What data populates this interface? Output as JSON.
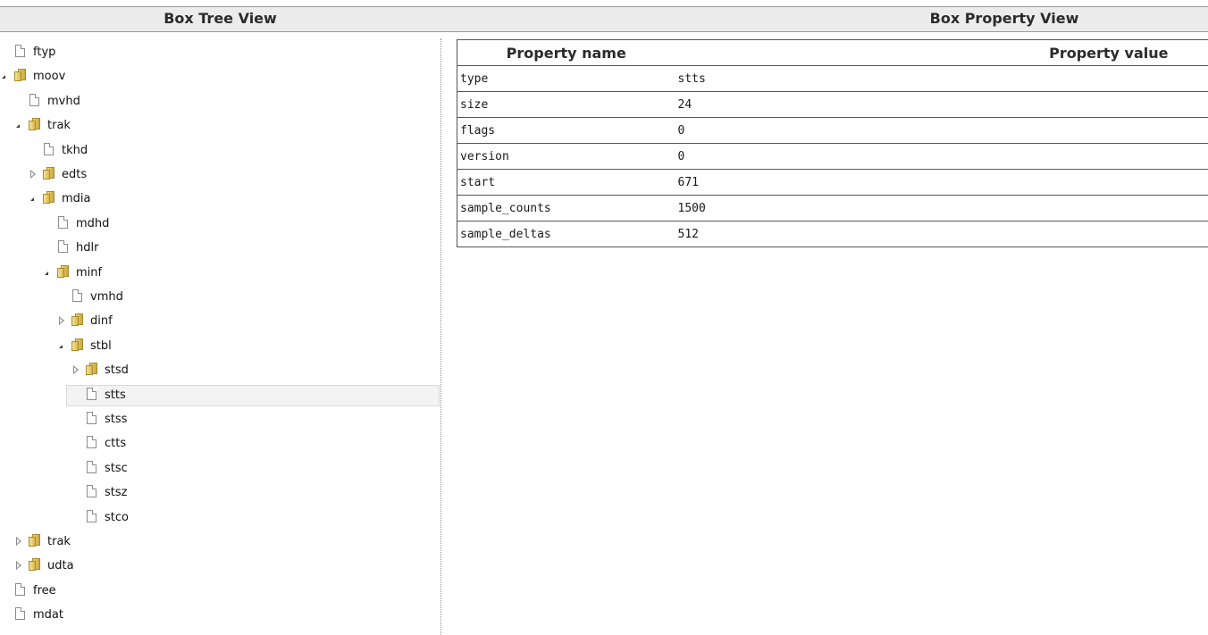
{
  "headers": {
    "tree_title": "Box Tree View",
    "property_title": "Box Property View"
  },
  "tree": {
    "nodes": [
      {
        "label": "ftyp",
        "icon": "file-icon",
        "toggle": "none",
        "depth": 0
      },
      {
        "label": "moov",
        "icon": "folder-icon",
        "toggle": "expanded",
        "depth": 0
      },
      {
        "label": "mvhd",
        "icon": "file-icon",
        "toggle": "none",
        "depth": 1
      },
      {
        "label": "trak",
        "icon": "folder-icon",
        "toggle": "expanded",
        "depth": 1
      },
      {
        "label": "tkhd",
        "icon": "file-icon",
        "toggle": "none",
        "depth": 2
      },
      {
        "label": "edts",
        "icon": "folder-icon",
        "toggle": "collapsed",
        "depth": 2
      },
      {
        "label": "mdia",
        "icon": "folder-icon",
        "toggle": "expanded",
        "depth": 2
      },
      {
        "label": "mdhd",
        "icon": "file-icon",
        "toggle": "none",
        "depth": 3
      },
      {
        "label": "hdlr",
        "icon": "file-icon",
        "toggle": "none",
        "depth": 3
      },
      {
        "label": "minf",
        "icon": "folder-icon",
        "toggle": "expanded",
        "depth": 3
      },
      {
        "label": "vmhd",
        "icon": "file-icon",
        "toggle": "none",
        "depth": 4
      },
      {
        "label": "dinf",
        "icon": "folder-icon",
        "toggle": "collapsed",
        "depth": 4
      },
      {
        "label": "stbl",
        "icon": "folder-icon",
        "toggle": "expanded",
        "depth": 4
      },
      {
        "label": "stsd",
        "icon": "folder-icon",
        "toggle": "collapsed",
        "depth": 5
      },
      {
        "label": "stts",
        "icon": "file-icon",
        "toggle": "none",
        "depth": 5,
        "selected": true
      },
      {
        "label": "stss",
        "icon": "file-icon",
        "toggle": "none",
        "depth": 5
      },
      {
        "label": "ctts",
        "icon": "file-icon",
        "toggle": "none",
        "depth": 5
      },
      {
        "label": "stsc",
        "icon": "file-icon",
        "toggle": "none",
        "depth": 5
      },
      {
        "label": "stsz",
        "icon": "file-icon",
        "toggle": "none",
        "depth": 5
      },
      {
        "label": "stco",
        "icon": "file-icon",
        "toggle": "none",
        "depth": 5
      },
      {
        "label": "trak",
        "icon": "folder-icon",
        "toggle": "collapsed",
        "depth": 1
      },
      {
        "label": "udta",
        "icon": "folder-icon",
        "toggle": "collapsed",
        "depth": 1
      },
      {
        "label": "free",
        "icon": "file-icon",
        "toggle": "none",
        "depth": 0
      },
      {
        "label": "mdat",
        "icon": "file-icon",
        "toggle": "none",
        "depth": 0
      }
    ]
  },
  "properties": {
    "columns": [
      "Property name",
      "Property value"
    ],
    "rows": [
      {
        "name": "type",
        "value": "stts"
      },
      {
        "name": "size",
        "value": "24"
      },
      {
        "name": "flags",
        "value": "0"
      },
      {
        "name": "version",
        "value": "0"
      },
      {
        "name": "start",
        "value": "671"
      },
      {
        "name": "sample_counts",
        "value": "1500"
      },
      {
        "name": "sample_deltas",
        "value": "512"
      }
    ]
  }
}
